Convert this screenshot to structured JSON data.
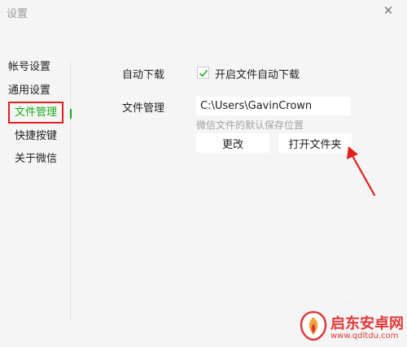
{
  "window": {
    "title": "设置",
    "close_glyph": "✕"
  },
  "sidebar": {
    "items": [
      {
        "label": "帐号设置"
      },
      {
        "label": "通用设置"
      },
      {
        "label": "文件管理",
        "active": true
      },
      {
        "label": "快捷按键"
      },
      {
        "label": "关于微信"
      }
    ]
  },
  "content": {
    "auto_download": {
      "label": "自动下载",
      "checkbox_label": "开启文件自动下载",
      "checked": true
    },
    "file_management": {
      "label": "文件管理",
      "path_value": "C:\\Users\\GavinCrown",
      "hint": "微信文件的默认保存位置",
      "change_button": "更改",
      "open_folder_button": "打开文件夹"
    }
  },
  "watermark": {
    "name": "启东安卓网",
    "url": "www.qdltdu.com"
  },
  "colors": {
    "accent_green": "#1aad19",
    "highlight_red": "#e02020",
    "watermark_red": "#e03a3a"
  }
}
